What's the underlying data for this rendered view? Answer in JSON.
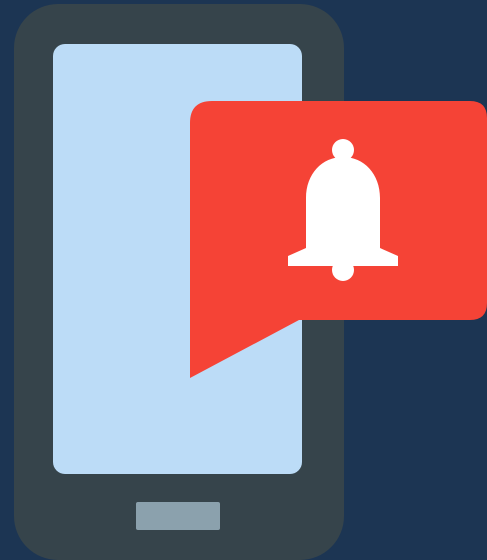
{
  "illustration": {
    "subject": "",
    "colors": {
      "background": "#1c3553",
      "phone_body": "#36444b",
      "phone_screen": "#bcdcf7",
      "home_button": "#8ba1ad",
      "notification_bubble": "#f54336",
      "bell": "#ffffff"
    },
    "icons": [
      "smartphone-icon",
      "speech-bubble-icon",
      "bell-icon"
    ]
  }
}
